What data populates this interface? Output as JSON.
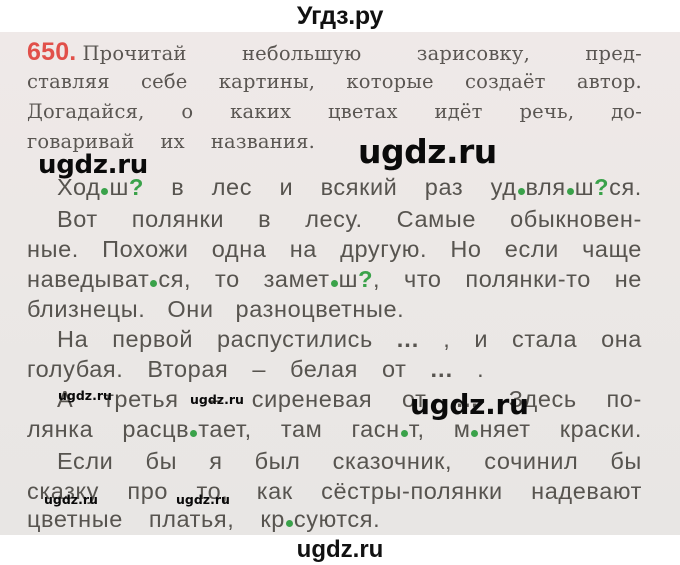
{
  "header": {
    "site_title": "Угдз.ру"
  },
  "footer": {
    "watermark": "ugdz.ru"
  },
  "exercise": {
    "number": "650.",
    "instruction_lines": [
      [
        "Прочитай",
        "небольшую",
        "зарисовку,",
        "пред-"
      ],
      [
        "ставляя",
        "себе",
        "картины,",
        "которые",
        "создаёт",
        "автор."
      ],
      [
        "Догадайся,",
        "о",
        "каких",
        "цветах",
        "идёт",
        "речь,",
        "до-"
      ],
      [
        "говаривай",
        "их",
        "названия."
      ]
    ],
    "text": {
      "l1": {
        "a": "Ход",
        "b": "ш",
        "q": "?",
        "c": "в",
        "d": "лес",
        "e": "и",
        "f": "всякий",
        "g": "раз",
        "h1": "уд",
        "h2": "вля",
        "h3": "ш",
        "h4": "ся."
      },
      "l2": [
        "Вот",
        "полянки",
        "в",
        "лесу.",
        "Самые",
        "обыкновен-"
      ],
      "l3": [
        "ные.",
        "Похожи",
        "одна",
        "на",
        "другую.",
        "Но",
        "если",
        "чаще"
      ],
      "l4": {
        "a": "наведыват",
        "b": "ся,",
        "c": "то",
        "d": "замет",
        "e": "ш",
        "q": "?",
        "comma": ",",
        "f": "что",
        "g": "полянки-то",
        "h": "не"
      },
      "l5": [
        "близнецы.",
        "Они",
        "разноцветные."
      ],
      "l6": {
        "a": "На",
        "b": "первой",
        "c": "распустились",
        "ell": "...",
        "comma": ",",
        "d": "и",
        "e": "стала",
        "f": "она"
      },
      "l7": {
        "a": "голубая.",
        "b": "Вторая",
        "dash": "–",
        "c": "белая",
        "d": "от",
        "ell": "...",
        "dot": "."
      },
      "l8": {
        "a": "А",
        "b": "третья",
        "dash": "–",
        "c": "сиреневая",
        "d": "от",
        "ell": "...",
        "e": "Здесь",
        "f": "по-"
      },
      "l9": {
        "a": "лянка",
        "b1": "расцв",
        "b2": "тает,",
        "c": "там",
        "d1": "гасн",
        "d2": "т,",
        "e1": "м",
        "e2": "няет",
        "f": "краски."
      },
      "l10": [
        "Если",
        "бы",
        "я",
        "был",
        "сказочник,",
        "сочинил",
        "бы"
      ],
      "l11": [
        "сказку",
        "про",
        "то,",
        "как",
        "сёстры-полянки",
        "надевают"
      ],
      "l12": {
        "a": "цветные",
        "b": "платья,",
        "c1": "кр",
        "c2": "суются."
      }
    }
  },
  "watermarks": {
    "left_top": "ugdz.ru",
    "center_top": "ugdz.ru",
    "mid_left": "ugdz.ru",
    "mid_center": "ugdz.ru",
    "mid_right": "ugdz.ru",
    "bottom_left": "ugdz.ru",
    "bottom_center": "ugdz.ru"
  },
  "colors": {
    "exercise_number": "#e1504a",
    "missing_letter_mark": "#3aa24a",
    "text": "#57544f",
    "page_background": "#ece8e6"
  }
}
